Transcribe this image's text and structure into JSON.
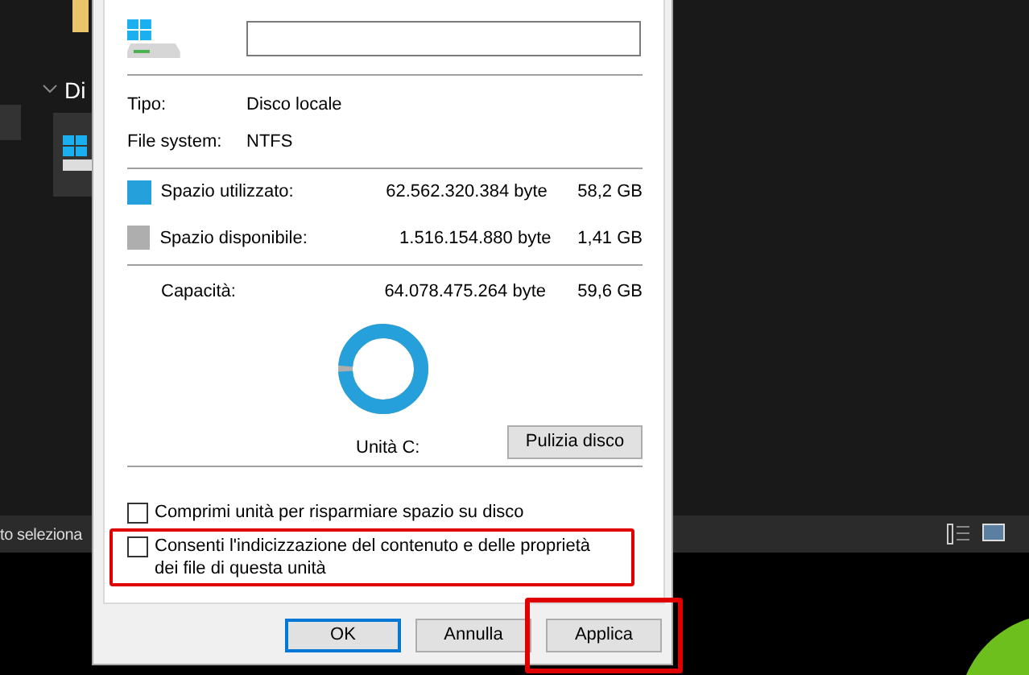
{
  "explorer": {
    "section_label": "Di",
    "status_text": "to seleziona"
  },
  "dialog": {
    "type_label": "Tipo:",
    "type_value": "Disco locale",
    "fs_label": "File system:",
    "fs_value": "NTFS",
    "space": [
      {
        "label": "Spazio utilizzato:",
        "bytes": "62.562.320.384 byte",
        "size": "58,2 GB",
        "color": "#26a0da"
      },
      {
        "label": "Spazio disponibile:",
        "bytes": "1.516.154.880 byte",
        "size": "1,41 GB",
        "color": "#aeaeae"
      }
    ],
    "capacity": {
      "label": "Capacità:",
      "bytes": "64.078.475.264 byte",
      "size": "59,6 GB"
    },
    "usage": {
      "level": 0.976
    },
    "drive_label": "Unità C:",
    "cleanup_button": "Pulizia disco",
    "options": [
      {
        "label": "Comprimi unità per risparmiare spazio su disco",
        "checked": false,
        "highlighted": false
      },
      {
        "label": "Consenti l'indicizzazione del contenuto e delle proprietà dei file di questa unità",
        "checked": false,
        "highlighted": true
      }
    ],
    "buttons": [
      {
        "label": "OK",
        "default": true,
        "highlighted": false
      },
      {
        "label": "Annulla",
        "default": false,
        "highlighted": false
      },
      {
        "label": "Applica",
        "default": false,
        "highlighted": true
      }
    ]
  }
}
